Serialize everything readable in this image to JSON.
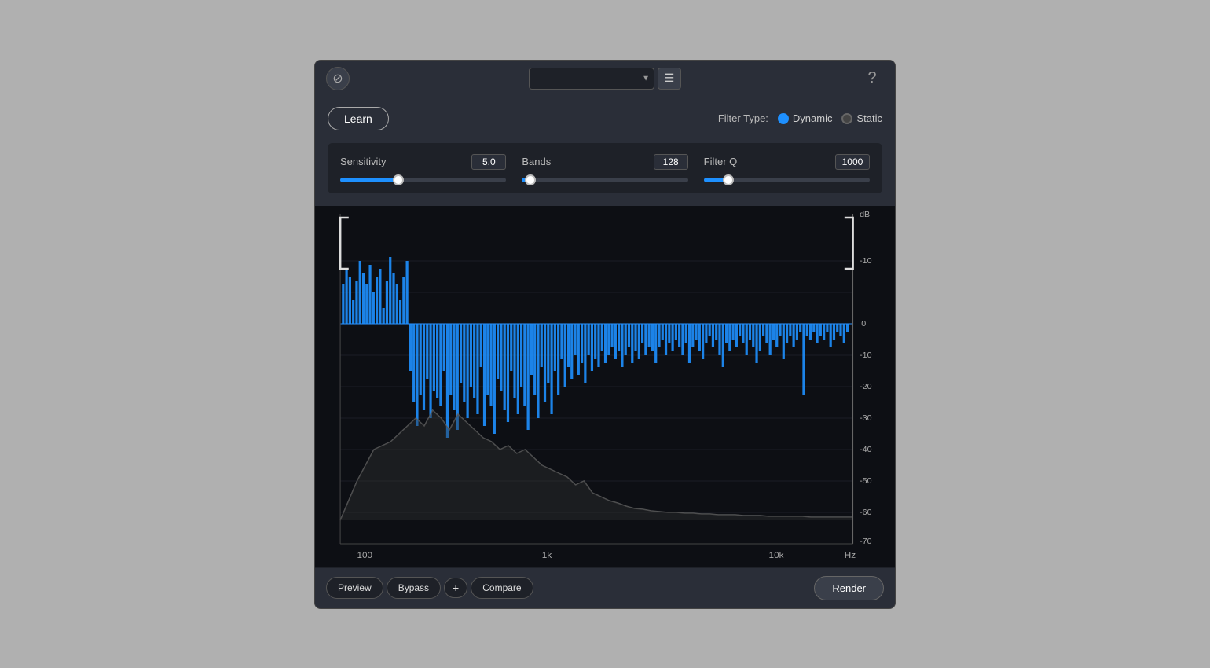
{
  "topbar": {
    "logo_icon": "⊘",
    "preset_placeholder": "",
    "hamburger_icon": "☰",
    "help_icon": "?"
  },
  "filter_row": {
    "learn_label": "Learn",
    "filter_type_label": "Filter Type:",
    "dynamic_label": "Dynamic",
    "static_label": "Static",
    "dynamic_active": true,
    "static_active": false
  },
  "sliders": {
    "sensitivity": {
      "label": "Sensitivity",
      "value": "5.0",
      "fill_percent": 35,
      "thumb_percent": 35
    },
    "bands": {
      "label": "Bands",
      "value": "128",
      "fill_percent": 5,
      "thumb_percent": 5
    },
    "filterq": {
      "label": "Filter Q",
      "value": "1000",
      "fill_percent": 15,
      "thumb_percent": 15
    }
  },
  "db_axis": {
    "labels": [
      "dB",
      "- 10",
      "- 0",
      "- 10",
      "- 20",
      "- 30",
      "- 40",
      "- 50",
      "- 60",
      "- 70"
    ]
  },
  "hz_axis": {
    "labels": [
      "100",
      "1k",
      "10k",
      "Hz"
    ]
  },
  "bottom": {
    "preview_label": "Preview",
    "bypass_label": "Bypass",
    "plus_label": "+",
    "compare_label": "Compare",
    "render_label": "Render"
  }
}
